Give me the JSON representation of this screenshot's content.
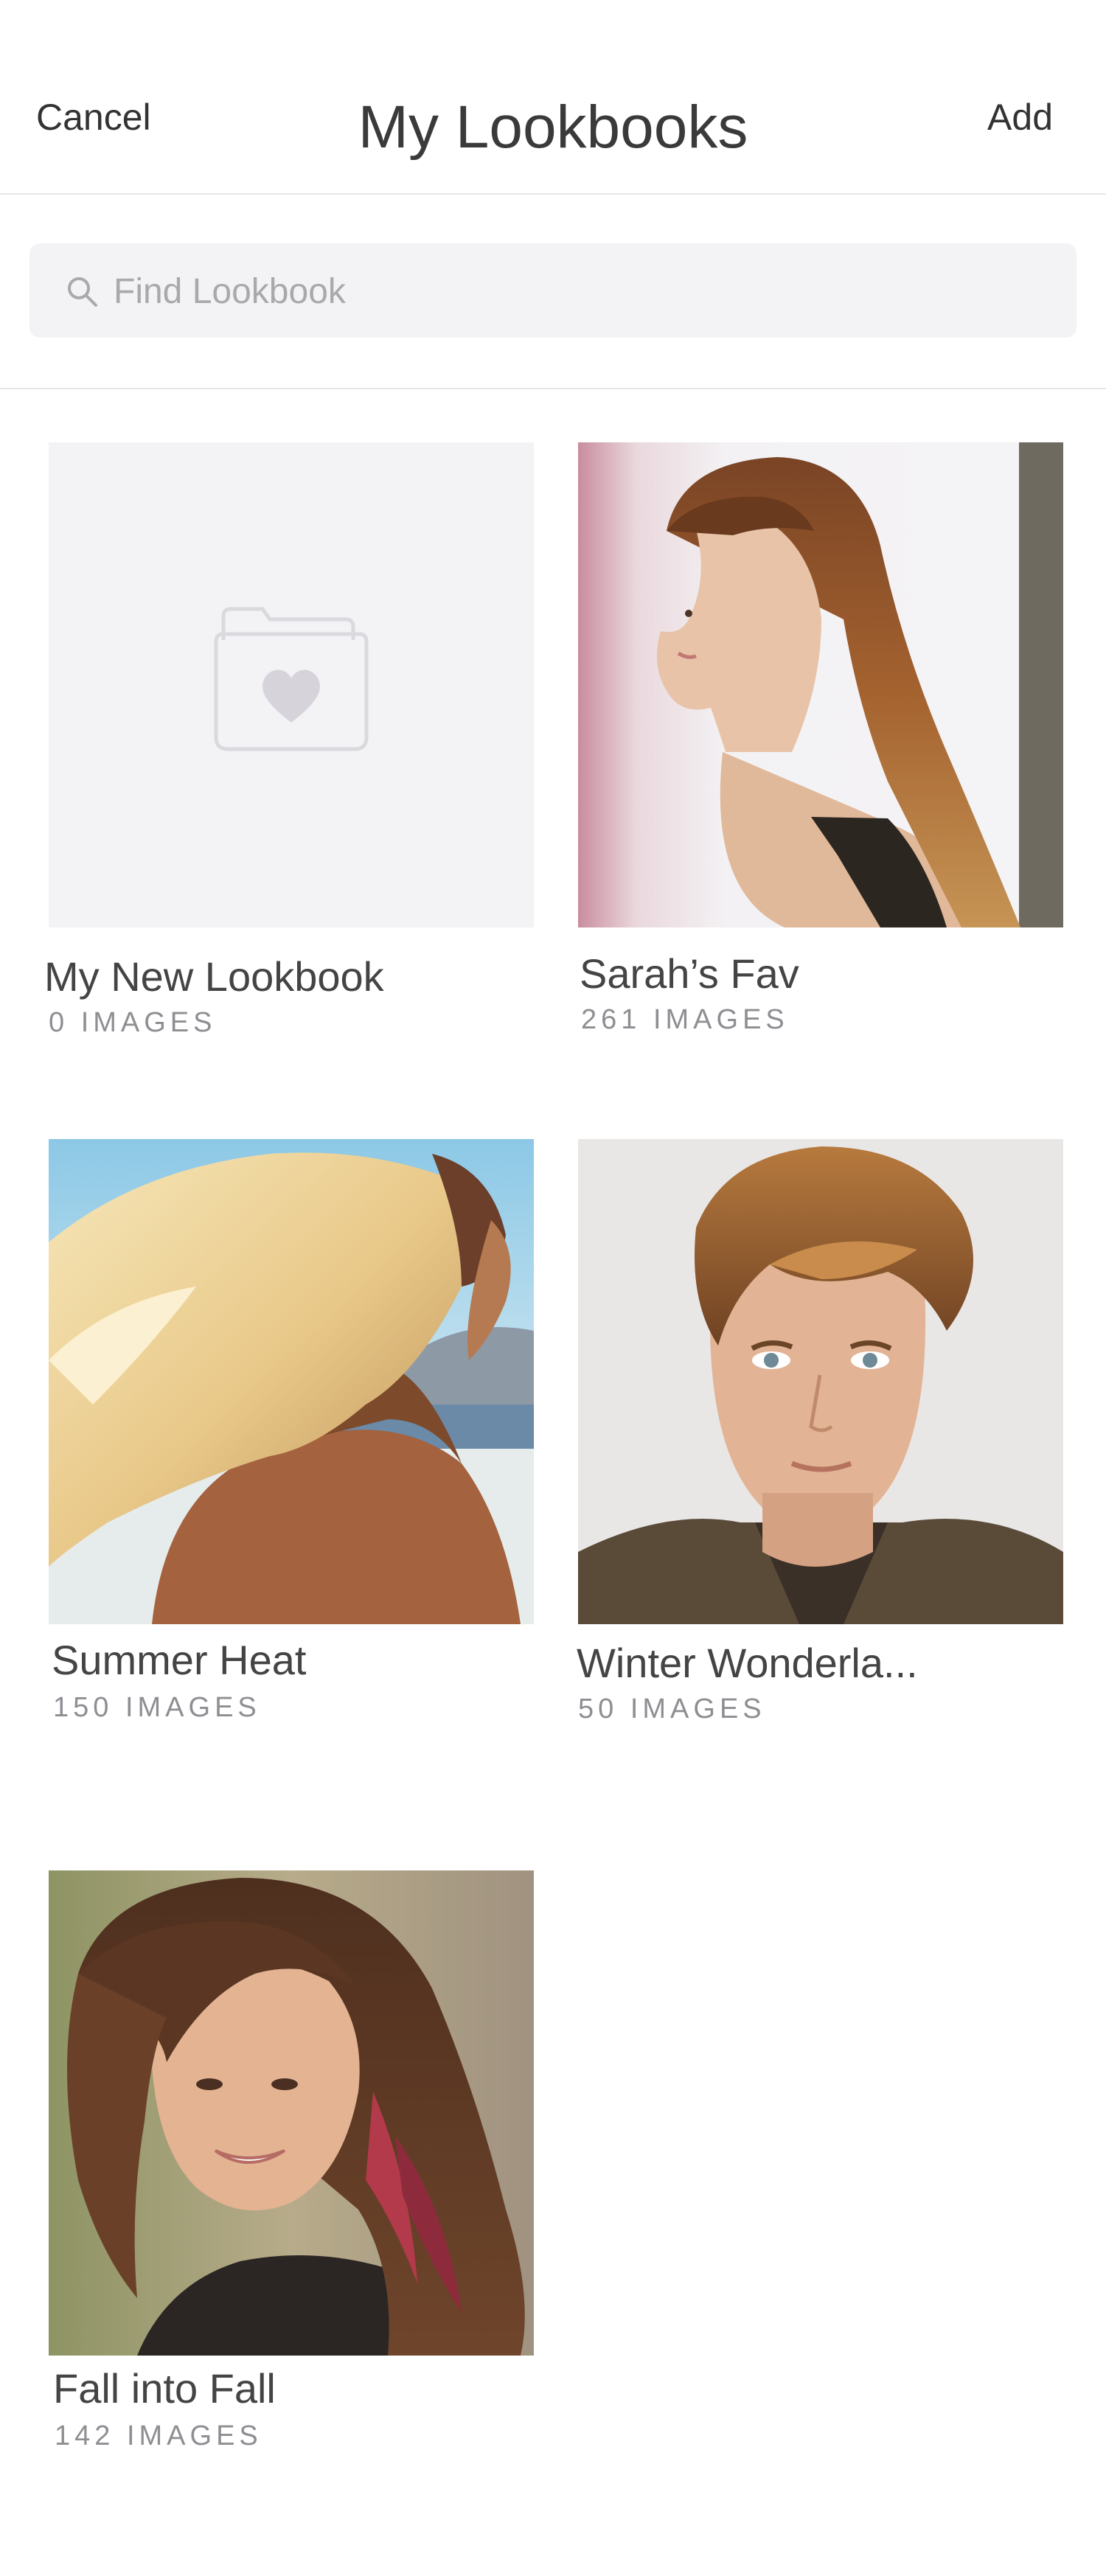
{
  "header": {
    "cancel_label": "Cancel",
    "title": "My Lookbooks",
    "add_label": "Add"
  },
  "search": {
    "placeholder": "Find Lookbook",
    "value": ""
  },
  "lookbooks": [
    {
      "name": "My New Lookbook",
      "count": "0 IMAGES",
      "thumbnail": "folder-heart-icon"
    },
    {
      "name": "Sarah’s Fav",
      "count": "261 IMAGES",
      "thumbnail": "photo-long-auburn-hair-side-profile"
    },
    {
      "name": "Summer Heat",
      "count": "150 IMAGES",
      "thumbnail": "photo-windblown-blonde-hair-beach"
    },
    {
      "name": "Winter Wonderla...",
      "count": "50 IMAGES",
      "thumbnail": "photo-man-brown-swept-hair"
    },
    {
      "name": "Fall into Fall",
      "count": "142 IMAGES",
      "thumbnail": "photo-woman-brunette-red-streak"
    }
  ],
  "colors": {
    "background": "#ffffff",
    "divider": "#e6e6e9",
    "search_bg": "#f3f3f6",
    "placeholder_text": "#a9a9ad",
    "count_text": "#8e8e93"
  }
}
